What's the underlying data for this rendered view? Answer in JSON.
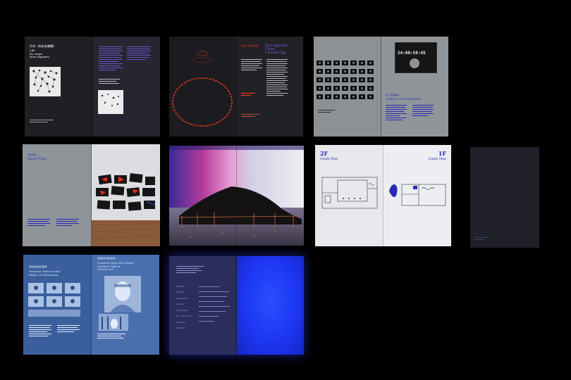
{
  "spreads": {
    "s1": {
      "zh_heading": "生命（宛若有機體）",
      "title": "Life\n(le corps\nsans organes)"
    },
    "s2": {
      "zh_heading": "空間（裂縫·間隔）",
      "title_line1": "Five Opposite",
      "title_line2": "Chess",
      "title_line3": "Counter Gap"
    },
    "s3": {
      "counter": "24:00:58:45",
      "title": "Archive of Deathclock",
      "zh_heading": "死亡計時檔案"
    },
    "s4": {
      "zh_heading": "空間時間",
      "title": "Space Time"
    },
    "s6": {
      "floor_left": "2F",
      "floor_right": "1F",
      "guide_left": "Guide Map",
      "guide_right": "Guide Map"
    },
    "s8": {
      "zh_heading_left": "游移在藝術的邊緣",
      "title_left": "Creators Talent in the\nEdges of Fukushima",
      "zh_heading_right": "音樂創作者的對話",
      "title_right": "Creators Meet the Future\nCreators Talk in\nChosen Art"
    },
    "s9": {
      "labels": [
        "Curator",
        "Artists",
        "Exhibition",
        "Venue",
        "Organizer",
        "Co-organizer",
        "Sponsor",
        "Design"
      ]
    }
  },
  "colors": {
    "accent_red": "#ff3b1f",
    "accent_purple": "#7a66ff",
    "glow_blue": "#1f3dff",
    "paper_dark": "#24242a",
    "paper_gray": "#8d9296",
    "paper_white": "#e8eaee"
  }
}
